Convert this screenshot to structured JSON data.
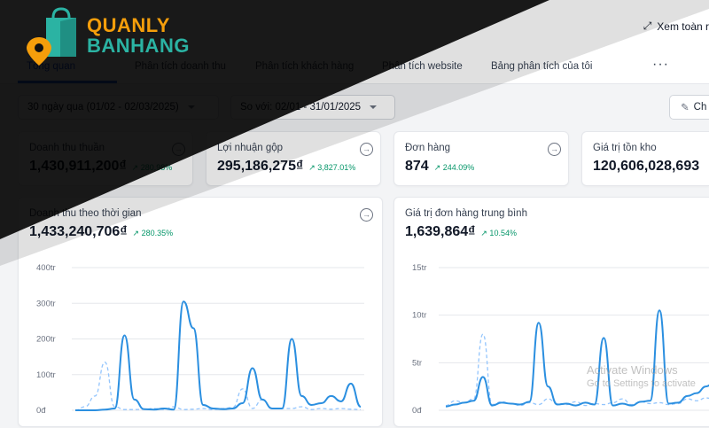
{
  "header": {
    "full_view_label": "Xem toàn r"
  },
  "logo": {
    "line1": "QUANLY",
    "line2": "BANHANG"
  },
  "tabs": [
    {
      "label": "Tổng quan",
      "active": true
    },
    {
      "label": "Phân tích doanh thu"
    },
    {
      "label": "Phân tích khách hàng"
    },
    {
      "label": "Phân tích website"
    },
    {
      "label": "Bảng phân tích của tôi"
    }
  ],
  "more_label": "···",
  "filters": {
    "period": "30 ngày qua (01/02 - 02/03/2025)",
    "compare": "So với: 02/01 - 31/01/2025",
    "edit_label": "Ch"
  },
  "kpis": [
    {
      "label": "Doanh thu thuần",
      "value": "1,430,911,200₫",
      "change": "↗ 280.98%"
    },
    {
      "label": "Lợi nhuận gộp",
      "value": "295,186,275₫",
      "change": "↗ 3,827.01%"
    },
    {
      "label": "Đơn hàng",
      "value": "874",
      "change": "↗ 244.09%"
    },
    {
      "label": "Giá trị tồn kho",
      "value": "120,606,028,693",
      "change": ""
    }
  ],
  "charts": {
    "revenue": {
      "title": "Doanh thu theo thời gian",
      "value": "1,433,240,706₫",
      "change": "↗ 280.35%"
    },
    "aov": {
      "title": "Giá trị đơn hàng trung bình",
      "value": "1,639,864₫",
      "change": "↗ 10.54%"
    }
  },
  "watermark": {
    "line1": "Activate Windows",
    "line2": "Go to Settings to activate"
  },
  "colors": {
    "accent": "#2563eb",
    "positive": "#059669",
    "logo": "#f59e0b",
    "line_current": "#2b8fe0",
    "line_previous": "#93c5fd"
  },
  "chart_data": [
    {
      "type": "line",
      "ylim": [
        0,
        400
      ],
      "yticks": [
        "0đ",
        "100tr",
        "200tr",
        "300tr",
        "400tr"
      ],
      "series": [
        {
          "style": "solid",
          "values": [
            0,
            0,
            0,
            2,
            5,
            210,
            30,
            3,
            2,
            5,
            2,
            305,
            230,
            15,
            5,
            3,
            5,
            20,
            118,
            30,
            5,
            5,
            200,
            40,
            15,
            20,
            40,
            25,
            75,
            10
          ]
        },
        {
          "style": "dashed",
          "values": [
            0,
            10,
            40,
            135,
            10,
            2,
            2,
            3,
            5,
            2,
            10,
            2,
            3,
            5,
            2,
            5,
            8,
            60,
            5,
            30,
            5,
            5,
            5,
            10,
            2,
            5,
            3,
            5,
            3,
            2
          ]
        }
      ]
    },
    {
      "type": "line",
      "ylim": [
        0,
        15
      ],
      "yticks": [
        "0đ",
        "5tr",
        "10tr",
        "15tr"
      ],
      "series": [
        {
          "style": "solid",
          "values": [
            0.4,
            0.6,
            0.8,
            1.0,
            3.5,
            0.5,
            0.8,
            0.7,
            0.6,
            0.9,
            9.2,
            2.5,
            0.6,
            0.7,
            0.5,
            0.8,
            0.6,
            7.6,
            0.5,
            0.7,
            0.5,
            0.9,
            1.0,
            10.5,
            0.7,
            0.8,
            1.5,
            1.8,
            2.5,
            3.0
          ]
        },
        {
          "style": "dashed",
          "values": [
            0.5,
            1.0,
            0.8,
            1.2,
            8.0,
            0.6,
            0.9,
            0.7,
            0.5,
            0.8,
            0.6,
            1.2,
            0.7,
            0.6,
            0.9,
            0.5,
            0.7,
            0.6,
            0.8,
            1.2,
            0.6,
            0.9,
            0.7,
            0.8,
            0.6,
            0.7,
            1.2,
            1.0,
            1.3,
            1.1
          ]
        }
      ]
    }
  ]
}
